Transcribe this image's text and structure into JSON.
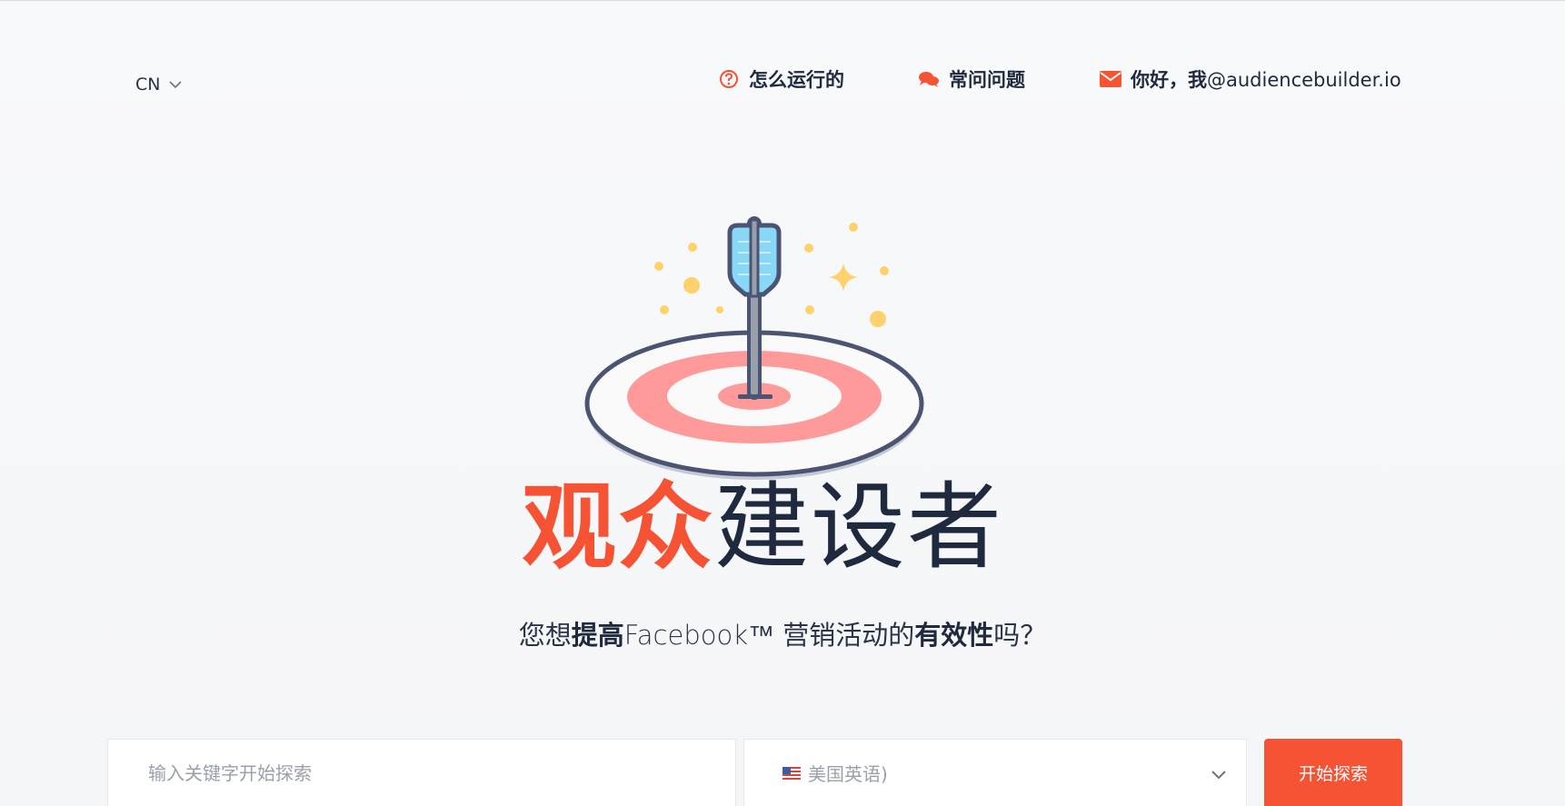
{
  "header": {
    "language": "CN",
    "nav": [
      {
        "label": "怎么运行的",
        "icon": "question-circle-icon"
      },
      {
        "label": "常问问题",
        "icon": "chat-bubbles-icon"
      },
      {
        "label_prefix": "你好，我",
        "label_email": "@audiencebuilder.io",
        "icon": "envelope-icon"
      }
    ]
  },
  "hero": {
    "illustration": "target-with-arrow-icon",
    "title_accent": "观众",
    "title_rest": "建设者",
    "subtitle": {
      "part1": "您想",
      "bold1": "提高",
      "part2": "Facebook™ 营销活动的",
      "bold2": "有效性",
      "part3": "吗？"
    }
  },
  "search": {
    "placeholder": "输入关键字开始探索",
    "locale_value": "美国英语)",
    "locale_flag": "us-flag-icon",
    "button_label": "开始探索"
  },
  "colors": {
    "accent": "#f65335",
    "text_dark": "#1f2a3f",
    "target_pink": "#ff9a9a",
    "sparkle_yellow": "#fdd26c",
    "feather_blue": "#8ad8f8"
  }
}
